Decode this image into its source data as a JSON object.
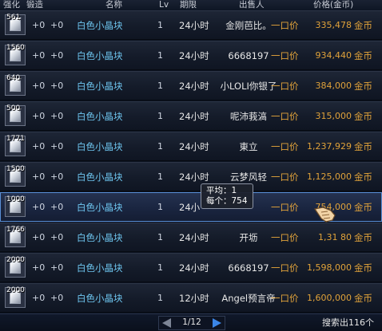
{
  "header": {
    "enhance": "强化",
    "refine": "锻造",
    "name": "名称",
    "lv": "Lv",
    "duration": "期限",
    "seller": "出售人",
    "price": "价格(金币)"
  },
  "rows": [
    {
      "qty": "561",
      "enhance": "+0",
      "refine": "+0",
      "name": "白色小晶块",
      "lv": "1",
      "duration": "24小时",
      "seller": "金刚芭比。",
      "type": "一口价",
      "price": "335,478",
      "unit": "金币"
    },
    {
      "qty": "1560",
      "enhance": "+0",
      "refine": "+0",
      "name": "白色小晶块",
      "lv": "1",
      "duration": "24小时",
      "seller": "6668197",
      "type": "一口价",
      "price": "934,440",
      "unit": "金币"
    },
    {
      "qty": "640",
      "enhance": "+0",
      "refine": "+0",
      "name": "白色小晶块",
      "lv": "1",
      "duration": "24小时",
      "seller": "小LOLI你银了",
      "type": "一口价",
      "price": "384,000",
      "unit": "金币"
    },
    {
      "qty": "500",
      "enhance": "+0",
      "refine": "+0",
      "name": "白色小晶块",
      "lv": "1",
      "duration": "24小时",
      "seller": "呢沛莪滈",
      "type": "一口价",
      "price": "315,000",
      "unit": "金币"
    },
    {
      "qty": "1771",
      "enhance": "+0",
      "refine": "+0",
      "name": "白色小晶块",
      "lv": "1",
      "duration": "24小时",
      "seller": "東立",
      "type": "一口价",
      "price": "1,237,929",
      "unit": "金币"
    },
    {
      "qty": "1500",
      "enhance": "+0",
      "refine": "+0",
      "name": "白色小晶块",
      "lv": "1",
      "duration": "24小时",
      "seller": "云梦风轻",
      "type": "一口价",
      "price": "1,125,000",
      "unit": "金币"
    },
    {
      "qty": "1000",
      "enhance": "+0",
      "refine": "+0",
      "name": "白色小晶块",
      "lv": "1",
      "duration": "24小",
      "seller": "",
      "type": "一口价",
      "price": "754,000",
      "unit": "金币"
    },
    {
      "qty": "1766",
      "enhance": "+0",
      "refine": "+0",
      "name": "白色小晶块",
      "lv": "1",
      "duration": "24小时",
      "seller": "开坜",
      "type": "一口价",
      "price": "1,31  80",
      "unit": "金币"
    },
    {
      "qty": "2000",
      "enhance": "+0",
      "refine": "+0",
      "name": "白色小晶块",
      "lv": "1",
      "duration": "24小时",
      "seller": "6668197",
      "type": "一口价",
      "price": "1,598,000",
      "unit": "金币"
    },
    {
      "qty": "2000",
      "enhance": "+0",
      "refine": "+0",
      "name": "白色小晶块",
      "lv": "1",
      "duration": "12小时",
      "seller": "Angel预言帝",
      "type": "一口价",
      "price": "1,600,000",
      "unit": "金币"
    }
  ],
  "selected_row": 6,
  "tooltip": {
    "line1": "平均：1",
    "line2": "每个：754"
  },
  "pager": {
    "text": "1/12"
  },
  "footer": {
    "total": "搜索出116个"
  },
  "colors": {
    "accent": "#5a8fd6",
    "price": "#e0a23a",
    "name": "#6ec6f0"
  }
}
